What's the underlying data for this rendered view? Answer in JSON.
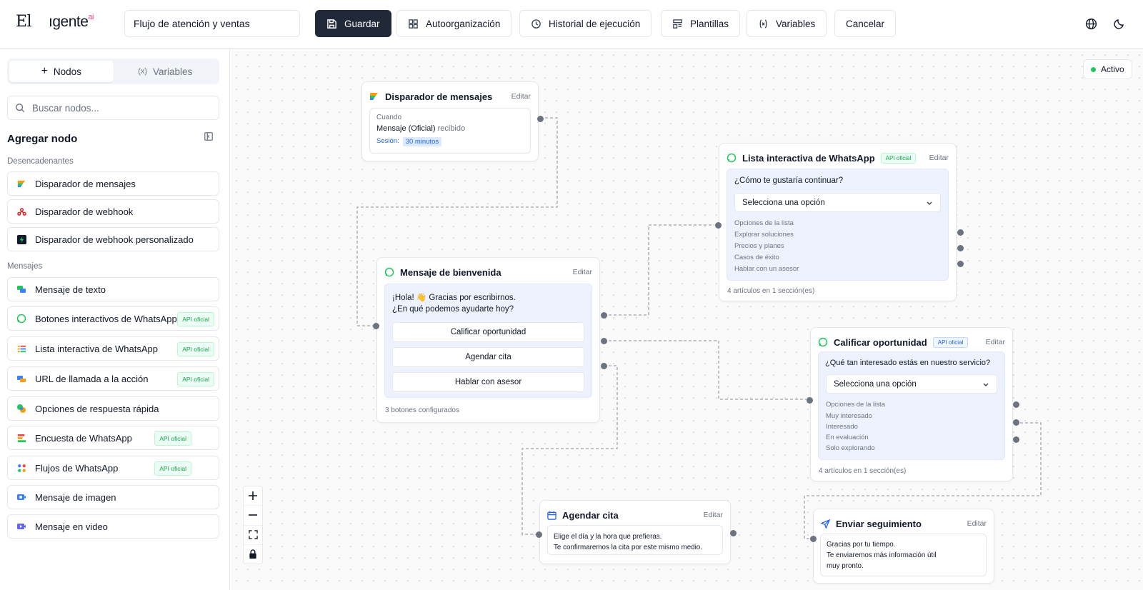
{
  "app": {
    "logo_left": "El",
    "logo_right": "ıgente",
    "logo_sup": "ai"
  },
  "header": {
    "flow_name": "Flujo de atención y ventas",
    "buttons": {
      "save": "Guardar",
      "autoorganize": "Autoorganización",
      "history": "Historial de ejecución",
      "templates": "Plantillas",
      "variables": "Variables",
      "cancel": "Cancelar"
    }
  },
  "sidebar": {
    "tabs": {
      "nodes": "Nodos",
      "variables": "Variables"
    },
    "search_placeholder": "Buscar nodos...",
    "add_node_title": "Agregar nodo",
    "sections": {
      "triggers": "Desencadenantes",
      "messages": "Mensajes"
    },
    "triggers": [
      {
        "label": "Disparador de mensajes",
        "icon": "message-trigger-icon"
      },
      {
        "label": "Disparador de webhook",
        "icon": "webhook-icon"
      },
      {
        "label": "Disparador de webhook personalizado",
        "icon": "bolt-icon"
      }
    ],
    "messages": [
      {
        "label": "Mensaje de texto",
        "icon": "chat-icon",
        "badge": ""
      },
      {
        "label": "Botones interactivos de WhatsApp",
        "icon": "whatsapp-icon",
        "badge": "API oficial"
      },
      {
        "label": "Lista interactiva de WhatsApp",
        "icon": "list-icon",
        "badge": "API oficial"
      },
      {
        "label": "URL de llamada a la acción",
        "icon": "link-icon",
        "badge": "API oficial"
      },
      {
        "label": "Opciones de respuesta rápida",
        "icon": "quick-reply-icon",
        "badge": ""
      },
      {
        "label": "Encuesta de WhatsApp",
        "icon": "poll-icon",
        "badge": "API oficial"
      },
      {
        "label": "Flujos de WhatsApp",
        "icon": "flows-icon",
        "badge": "API oficial"
      },
      {
        "label": "Mensaje de imagen",
        "icon": "image-icon",
        "badge": ""
      },
      {
        "label": "Mensaje en video",
        "icon": "video-icon",
        "badge": ""
      }
    ]
  },
  "canvas": {
    "status": "Activo",
    "nodes": {
      "trigger": {
        "title": "Disparador de mensajes",
        "edit": "Editar",
        "when_label": "Cuando",
        "message_type": "Mensaje (Oficial)",
        "received": "recibido",
        "session_label": "Sesión:",
        "session_value": "30 minutos"
      },
      "welcome": {
        "title": "Mensaje de bienvenida",
        "edit": "Editar",
        "line1": "¡Hola! 👋 Gracias por escribirnos.",
        "line2": "¿En qué podemos ayudarte hoy?",
        "buttons": [
          "Calificar oportunidad",
          "Agendar cita",
          "Hablar con asesor"
        ],
        "footer": "3 botones configurados"
      },
      "list": {
        "title": "Lista interactiva de WhatsApp",
        "badge": "API oficial",
        "edit": "Editar",
        "question": "¿Cómo te gustaría continuar?",
        "select": "Selecciona una opción",
        "options_label": "Opciones de la lista",
        "options": [
          "Explorar soluciones",
          "Precios y planes",
          "Casos de éxito",
          "Hablar con un asesor"
        ],
        "footer": "4 artículos en 1 sección(es)"
      },
      "qualify": {
        "title": "Calificar oportunidad",
        "badge": "API oficial",
        "edit": "Editar",
        "question": "¿Qué tan interesado estás en nuestro servicio?",
        "select": "Selecciona una opción",
        "options_label": "Opciones de la lista",
        "options": [
          "Muy interesado",
          "Interesado",
          "En evaluación",
          "Solo explorando"
        ],
        "footer": "4 artículos en 1 sección(es)"
      },
      "appointment": {
        "title": "Agendar cita",
        "edit": "Editar",
        "line1": "Elige el día y la hora que prefieras.",
        "line2": "Te confirmaremos la cita por este mismo medio."
      },
      "followup": {
        "title": "Enviar seguimiento",
        "edit": "Editar",
        "line1": "Gracias por tu tiempo.",
        "line2": "Te enviaremos más información útil",
        "line3": "muy pronto."
      }
    }
  },
  "colors": {
    "primary": "#1f2937",
    "accent_green": "#22c55e",
    "whatsapp": "#25d366",
    "badge_green": "#16a34a",
    "node_blue_bg": "#eef2ff"
  }
}
